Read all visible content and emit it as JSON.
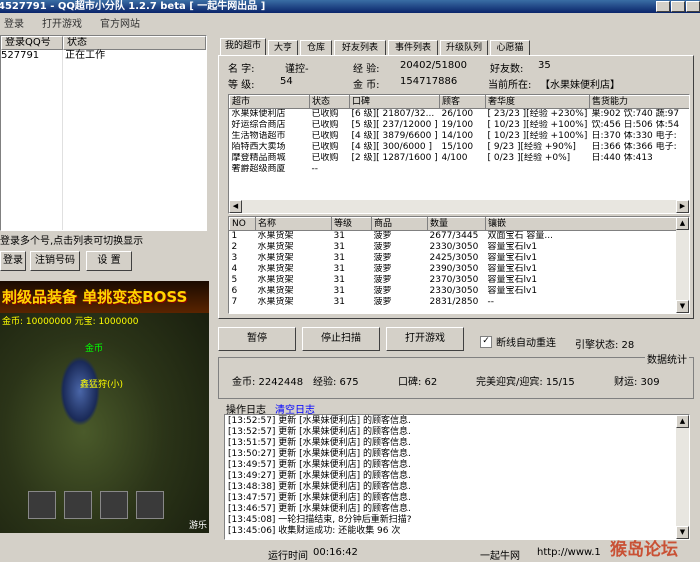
{
  "window": {
    "title": "4527791 - QQ超市小分队 1.2.7 beta [ 一起牛网出品 ]"
  },
  "menu": [
    "登录",
    "打开游戏",
    "官方网站"
  ],
  "accounts": {
    "headers": [
      "登录QQ号",
      "状态"
    ],
    "rows": [
      {
        "qq": "527791",
        "status": "正在工作"
      }
    ],
    "hint": "登录多个号,点击列表可切换显示",
    "buttons": [
      "登录",
      "注销号码",
      "设 置"
    ]
  },
  "game": {
    "banner": "刺级品装备 单挑变态BOSS",
    "gold_line": "金币: 10000000  元宝: 1000000",
    "char_name": "金币",
    "char_label": "鑫猛狩(小)",
    "corner_label": "游乐"
  },
  "tabs": [
    "我的超市",
    "大亨",
    "仓库",
    "好友列表",
    "事件列表",
    "升级队列",
    "心愿猫"
  ],
  "info": {
    "name_label": "名 字:",
    "name": "谨控-",
    "exp_label": "经 验:",
    "exp": "20402/51800",
    "friends_label": "好友数:",
    "friends": "35",
    "level_label": "等 级:",
    "level": "54",
    "gold_label": "金 币:",
    "gold": "154717886",
    "location_label": "当前所在:",
    "location": "【水果妹便利店】"
  },
  "markets": {
    "headers": [
      "超市",
      "状态",
      "口碑",
      "顾客",
      "奢华度",
      "售货能力"
    ],
    "rows": [
      [
        "水果妹便利店",
        "已收购",
        "[6 级][ 21807/32...",
        "26/100",
        "[ 23/23 ][经验 +230%]",
        "果:902 饮:740 蔬:97"
      ],
      [
        "好运综合商店",
        "已收购",
        "[5 级][ 237/12000 ]",
        "19/100",
        "[ 10/23 ][经验 +100%]",
        "饮:456 日:506 体:54"
      ],
      [
        "生活物语超市",
        "已收购",
        "[4 级][ 3879/6600 ]",
        "14/100",
        "[ 10/23 ][经验 +100%]",
        "日:370 体:330 电子:"
      ],
      [
        "陌特西大卖场",
        "已收购",
        "[4 级][ 300/6000 ]",
        "15/100",
        "[ 9/23 ][经验 +90%]",
        "日:366 体:366 电子:"
      ],
      [
        "摩登精品商城",
        "已收购",
        "[2 级][ 1287/1600 ]",
        "4/100",
        "[ 0/23 ][经验 +0%]",
        "日:440 体:413"
      ],
      [
        "奢爵超级商厦",
        "--",
        "",
        "",
        "",
        ""
      ]
    ]
  },
  "shelves": {
    "headers": [
      "NO",
      "名称",
      "等级",
      "商品",
      "数量",
      "镶嵌"
    ],
    "rows": [
      [
        "1",
        "水果货架",
        "31",
        "菠萝",
        "2677/3445",
        "双面宝石 容量..."
      ],
      [
        "2",
        "水果货架",
        "31",
        "菠萝",
        "2330/3050",
        "容量宝石lv1"
      ],
      [
        "3",
        "水果货架",
        "31",
        "菠萝",
        "2425/3050",
        "容量宝石lv1"
      ],
      [
        "4",
        "水果货架",
        "31",
        "菠萝",
        "2390/3050",
        "容量宝石lv1"
      ],
      [
        "5",
        "水果货架",
        "31",
        "菠萝",
        "2370/3050",
        "容量宝石lv1"
      ],
      [
        "6",
        "水果货架",
        "31",
        "菠萝",
        "2330/3050",
        "容量宝石lv1"
      ],
      [
        "7",
        "水果货架",
        "31",
        "菠萝",
        "2831/2850",
        "--"
      ]
    ]
  },
  "controls": {
    "pause": "暂停",
    "stop": "停止扫描",
    "open_game": "打开游戏",
    "reconnect": "断线自动重连",
    "reconnect_checked": true,
    "lock_status": "引擎状态: 28"
  },
  "stats": {
    "title": "数据统计",
    "gold": "金币: 2242448",
    "exp": "经验: 675",
    "reputation": "口碑: 62",
    "perfect": "完美迎宾/迎宾: 15/15",
    "wealth": "财运: 309"
  },
  "log": {
    "tab_label": "操作日志",
    "clear_label": "清空日志",
    "lines": [
      "[13:52:57] 更新 [水果妹便利店] 的顾客信息.",
      "[13:52:57] 更新 [水果妹便利店] 的顾客信息.",
      "[13:51:57] 更新 [水果妹便利店] 的顾客信息.",
      "[13:50:27] 更新 [水果妹便利店] 的顾客信息.",
      "[13:49:57] 更新 [水果妹便利店] 的顾客信息.",
      "[13:49:27] 更新 [水果妹便利店] 的顾客信息.",
      "[13:48:38] 更新 [水果妹便利店] 的顾客信息.",
      "[13:47:57] 更新 [水果妹便利店] 的顾客信息.",
      "[13:46:57] 更新 [水果妹便利店] 的顾客信息.",
      "[13:45:08] 一轮扫描结束, 8分钟后重新扫描?",
      "[13:45:06] 收集财运成功: 还能收集 96 次"
    ]
  },
  "status": {
    "runtime_label": "运行时间",
    "runtime": "00:16:42",
    "brand": "一起牛网",
    "url": "http://www.1",
    "watermark": "猴岛论坛"
  },
  "colors": {
    "title_bar": "#0a246a",
    "link": "#0000ff",
    "panel": "#d4d0c8"
  }
}
